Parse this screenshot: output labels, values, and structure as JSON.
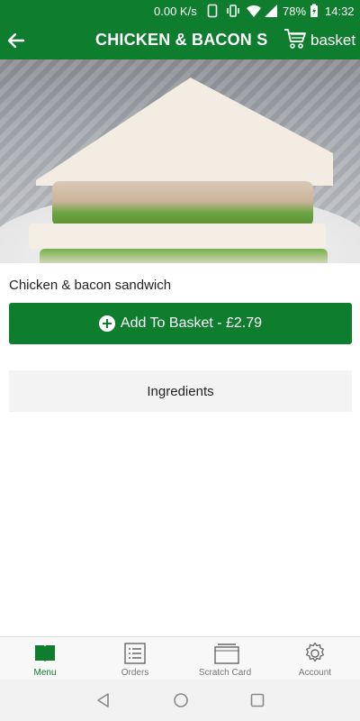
{
  "status_bar": {
    "net_speed": "0.00 K/s",
    "battery": "78%",
    "time": "14:32"
  },
  "app_bar": {
    "title": "CHICKEN & BACON S...",
    "basket_label": "basket"
  },
  "hero": {
    "image_alt": "Chicken & bacon sandwich"
  },
  "product": {
    "name": "Chicken & bacon sandwich",
    "add_button_label": "Add To Basket - £2.79",
    "ingredients_label": "Ingredients"
  },
  "bottom_nav": {
    "items": [
      {
        "label": "Menu",
        "icon": "book-icon",
        "active": true
      },
      {
        "label": "Orders",
        "icon": "list-icon",
        "active": false
      },
      {
        "label": "Scratch Card",
        "icon": "card-icon",
        "active": false
      },
      {
        "label": "Account",
        "icon": "gear-icon",
        "active": false
      }
    ]
  },
  "colors": {
    "brand_green": "#0e7d2e",
    "button_text": "#ffffff",
    "ingredients_bg": "#f3f3f3"
  }
}
